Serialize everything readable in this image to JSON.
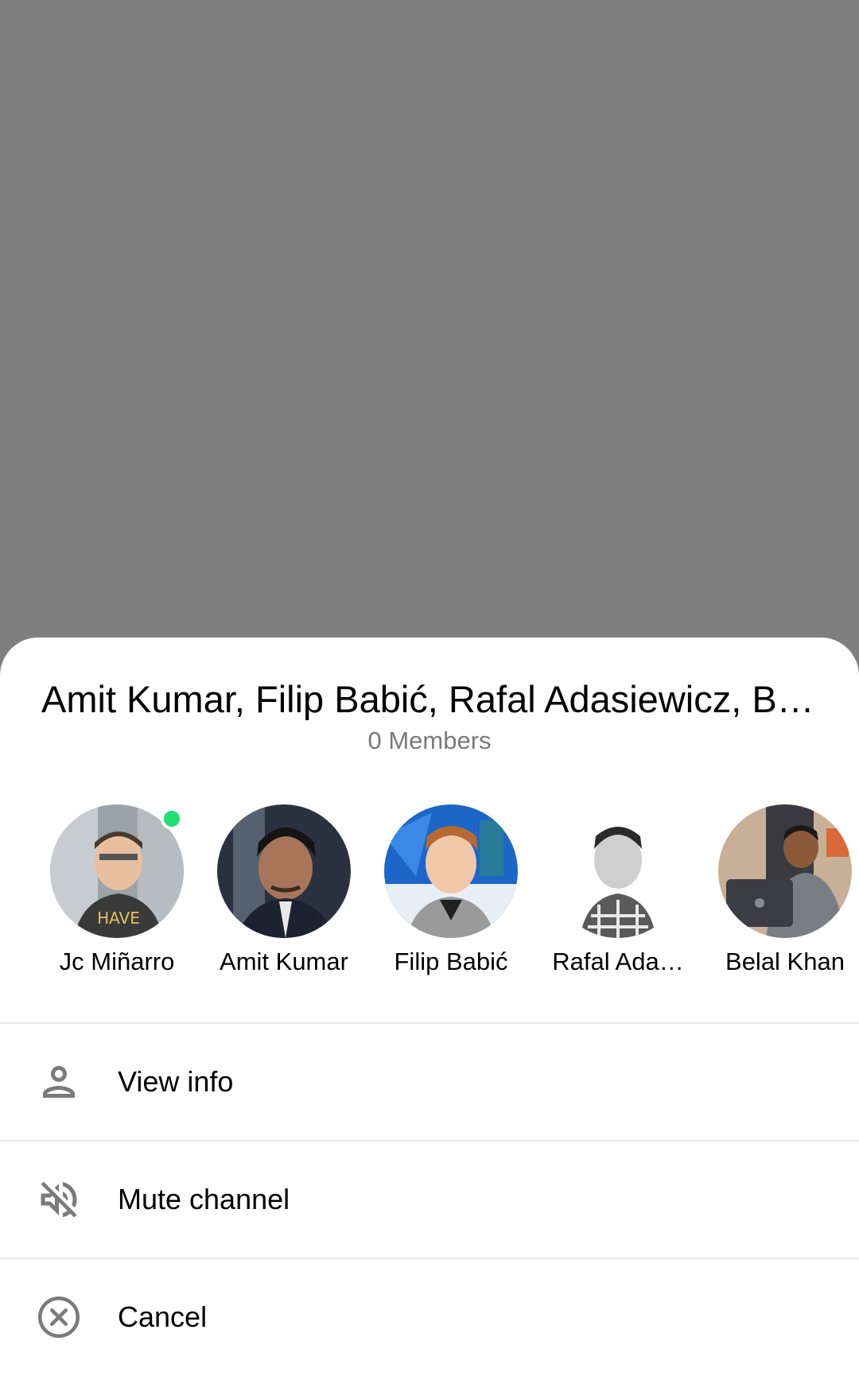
{
  "sheet": {
    "title": "Amit Kumar, Filip Babić, Rafal Adasiewicz, Bel…",
    "subtitle": "0 Members"
  },
  "members": [
    {
      "name": "Jc Miñarro",
      "online": true,
      "avatar_icon": "user-avatar"
    },
    {
      "name": "Amit Kumar",
      "online": false,
      "avatar_icon": "user-avatar"
    },
    {
      "name": "Filip Babić",
      "online": false,
      "avatar_icon": "user-avatar"
    },
    {
      "name": "Rafal Ada…",
      "online": false,
      "avatar_icon": "user-avatar"
    },
    {
      "name": "Belal Khan",
      "online": false,
      "avatar_icon": "user-avatar"
    }
  ],
  "actions": [
    {
      "label": "View info",
      "icon": "person-icon"
    },
    {
      "label": "Mute channel",
      "icon": "volume-off-icon"
    },
    {
      "label": "Cancel",
      "icon": "close-circle-icon"
    }
  ],
  "colors": {
    "scrim": "#7f7f7f",
    "sheet": "#ffffff",
    "online": "#20e070",
    "subtitle": "#7a7a7a",
    "icon": "#7a7a7a",
    "divider": "#e6e6e6"
  }
}
